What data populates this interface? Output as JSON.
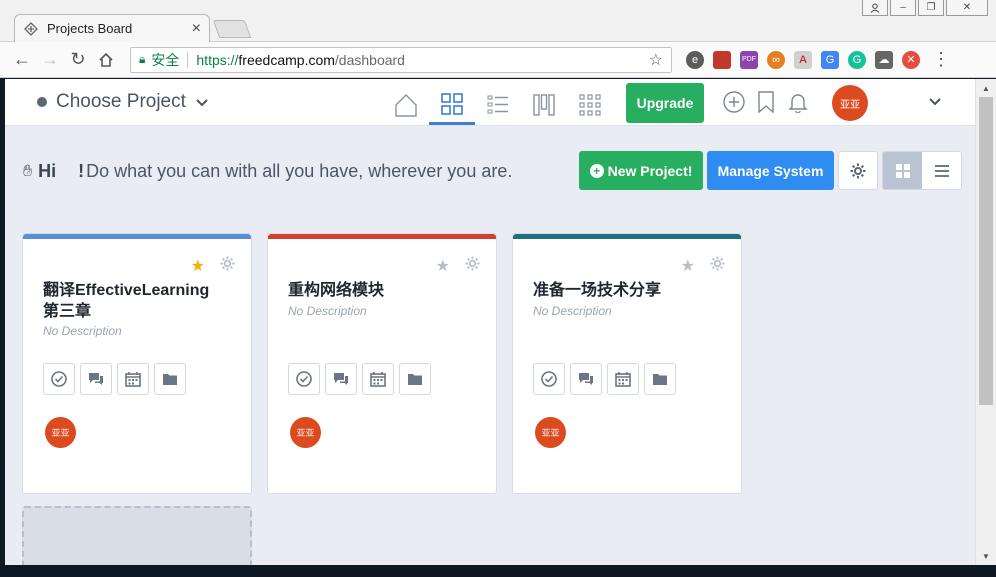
{
  "browser": {
    "tab_title": "Projects Board",
    "secure_label": "安全",
    "url_protocol": "https://",
    "url_host": "freedcamp.com",
    "url_path": "/dashboard"
  },
  "header": {
    "project_selector": "Choose Project",
    "upgrade_label": "Upgrade",
    "avatar_text": "亚亚"
  },
  "greeting": {
    "hi": "Hi",
    "bang": "!",
    "message": "Do what you can with all you have, wherever you are."
  },
  "actions": {
    "new_project": "New Project!",
    "manage_system": "Manage System"
  },
  "projects": [
    {
      "title": "翻译EffectiveLearning第三章",
      "description": "No Description",
      "color": "#5b8fd4",
      "starred": true,
      "avatar": "亚亚"
    },
    {
      "title": "重构网络模块",
      "description": "No Description",
      "color": "#d23f31",
      "starred": false,
      "avatar": "亚亚"
    },
    {
      "title": "准备一场技术分享",
      "description": "No Description",
      "color": "#1f6f7e",
      "starred": false,
      "avatar": "亚亚"
    }
  ],
  "colors": {
    "accent_green": "#27ae60",
    "accent_blue": "#2f8cf0",
    "avatar_red": "#dc4a1f",
    "star_gold": "#f0b400",
    "star_grey": "#b7bfcc"
  }
}
